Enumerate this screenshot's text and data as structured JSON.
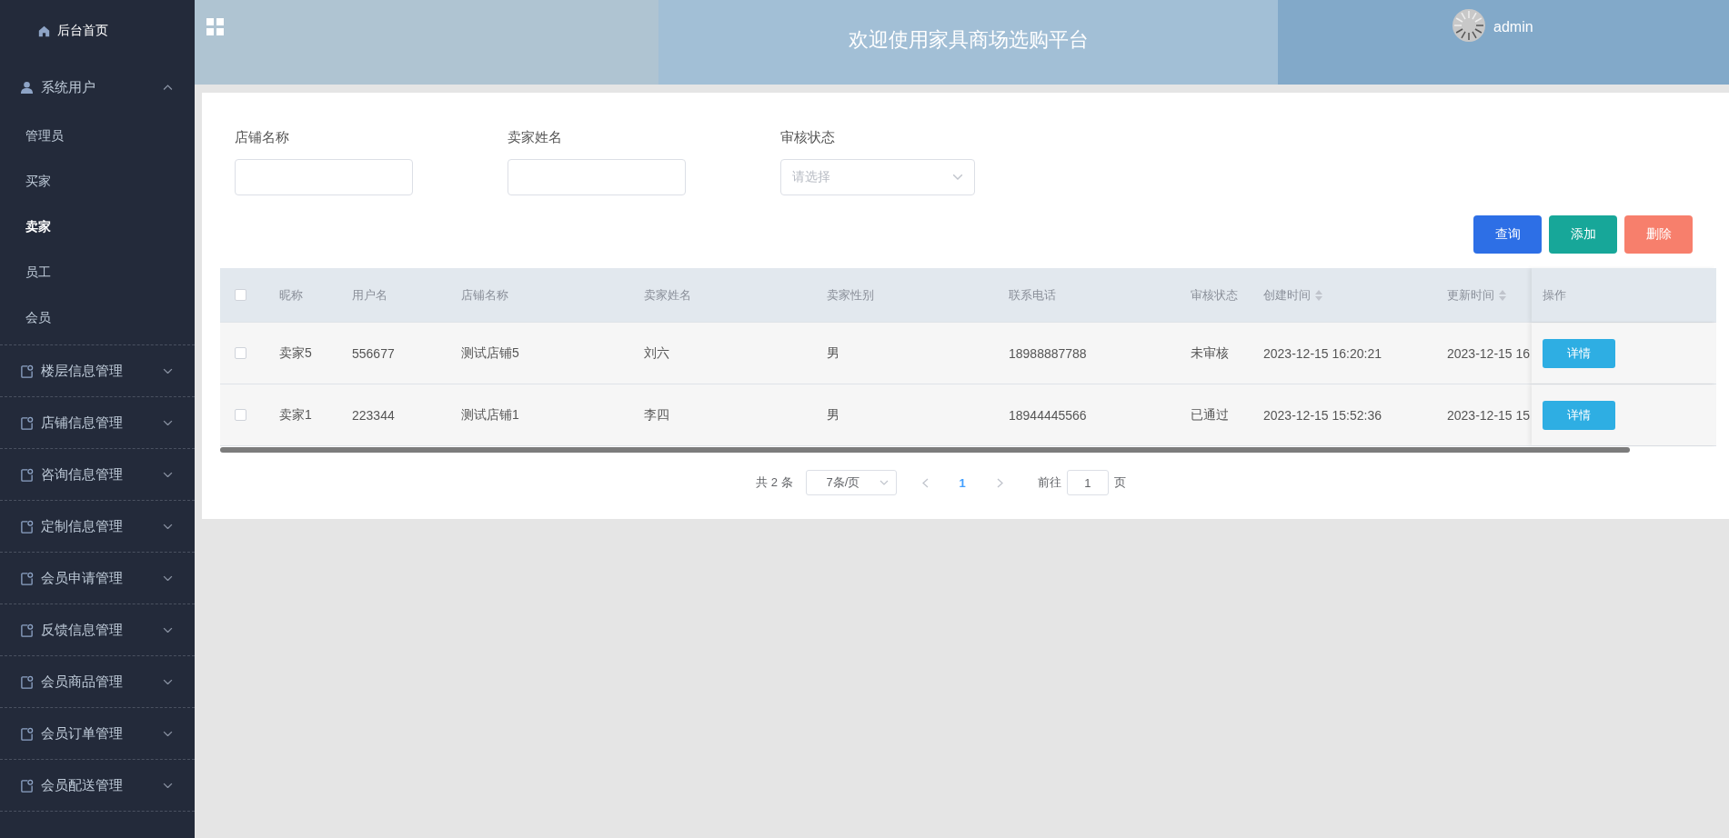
{
  "sidebar": {
    "home": {
      "label": "后台首页"
    },
    "menus": [
      {
        "label": "系统用户",
        "kind": "user",
        "expanded": true,
        "children": [
          {
            "label": "管理员",
            "selected": false
          },
          {
            "label": "买家",
            "selected": false
          },
          {
            "label": "卖家",
            "selected": true
          },
          {
            "label": "员工",
            "selected": false
          },
          {
            "label": "会员",
            "selected": false
          }
        ]
      },
      {
        "label": "楼层信息管理",
        "kind": "module",
        "expanded": false
      },
      {
        "label": "店铺信息管理",
        "kind": "module",
        "expanded": false
      },
      {
        "label": "咨询信息管理",
        "kind": "module",
        "expanded": false
      },
      {
        "label": "定制信息管理",
        "kind": "module",
        "expanded": false
      },
      {
        "label": "会员申请管理",
        "kind": "module",
        "expanded": false
      },
      {
        "label": "反馈信息管理",
        "kind": "module",
        "expanded": false
      },
      {
        "label": "会员商品管理",
        "kind": "module",
        "expanded": false
      },
      {
        "label": "会员订单管理",
        "kind": "module",
        "expanded": false
      },
      {
        "label": "会员配送管理",
        "kind": "module",
        "expanded": false
      }
    ]
  },
  "header": {
    "title": "欢迎使用家具商场选购平台",
    "user": "admin"
  },
  "filters": [
    {
      "label": "店铺名称",
      "kind": "input"
    },
    {
      "label": "卖家姓名",
      "kind": "input"
    },
    {
      "label": "审核状态",
      "kind": "select",
      "placeholder": "请选择"
    }
  ],
  "actions": [
    {
      "label": "查询",
      "color": "#2d6fe6"
    },
    {
      "label": "添加",
      "color": "#17a799"
    },
    {
      "label": "删除",
      "color": "#f77f6c"
    }
  ],
  "table": {
    "all_checked": false,
    "columns": [
      {
        "label": "昵称",
        "sortable": false
      },
      {
        "label": "用户名",
        "sortable": false
      },
      {
        "label": "店铺名称",
        "sortable": false
      },
      {
        "label": "卖家姓名",
        "sortable": false
      },
      {
        "label": "卖家性别",
        "sortable": false
      },
      {
        "label": "联系电话",
        "sortable": false
      },
      {
        "label": "审核状态",
        "sortable": false
      },
      {
        "label": "创建时间",
        "sortable": true
      },
      {
        "label": "更新时间",
        "sortable": true
      },
      {
        "label": "操作",
        "sortable": false
      }
    ],
    "rows": [
      {
        "checked": false,
        "cells": [
          "卖家5",
          "556677",
          "测试店铺5",
          "刘六",
          "男",
          "18988887788",
          "未审核",
          "2023-12-15 16:20:21",
          "2023-12-15 16"
        ],
        "button": "详情"
      },
      {
        "checked": false,
        "cells": [
          "卖家1",
          "223344",
          "测试店铺1",
          "李四",
          "男",
          "18944445566",
          "已通过",
          "2023-12-15 15:52:36",
          "2023-12-15 15"
        ],
        "button": "详情"
      }
    ]
  },
  "pagination": {
    "total": "共 2 条",
    "page_size": "7条/页",
    "prev_disabled": true,
    "next_disabled": true,
    "pages": [
      {
        "label": "1",
        "selected": true
      }
    ],
    "jump_label": "前往",
    "jump_value": "1",
    "jump_suffix": "页"
  }
}
